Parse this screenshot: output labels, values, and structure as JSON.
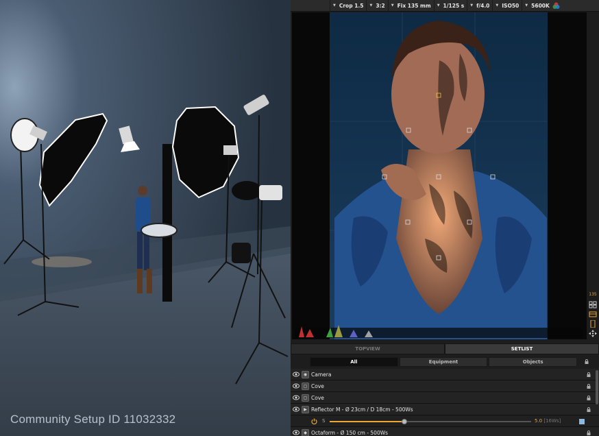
{
  "viewport": {
    "community_label": "Community Setup ID 11032332"
  },
  "camera_toolbar": {
    "items": [
      {
        "label": "Crop 1.5"
      },
      {
        "label": "3:2"
      },
      {
        "label": "Fix 135 mm"
      },
      {
        "label": "1/125 s"
      },
      {
        "label": "f/4.0"
      },
      {
        "label": "ISO50"
      },
      {
        "label": "5600K"
      }
    ],
    "color_icon": "color-wheel-icon"
  },
  "side_strip": {
    "value": "135"
  },
  "view_tabs": [
    {
      "label": "TOPVIEW",
      "active": false
    },
    {
      "label": "SETLIST",
      "active": true
    }
  ],
  "filter_tabs": [
    {
      "label": "All",
      "active": true
    },
    {
      "label": "Equipment",
      "active": false
    },
    {
      "label": "Objects",
      "active": false
    }
  ],
  "setlist": {
    "rows": [
      {
        "label": "Camera",
        "icon": "camera-icon"
      },
      {
        "label": "Cove",
        "icon": "cove-icon"
      },
      {
        "label": "Cove",
        "icon": "cove-icon"
      },
      {
        "label": "Reflector M - Ø 23cm / D 18cm - 500Ws",
        "icon": "reflector-icon"
      },
      {
        "label": "Octaform - Ø 150 cm - 500Ws",
        "icon": "octaform-icon"
      }
    ],
    "slider": {
      "letter": "S",
      "value": "5.0",
      "suffix": "[16Ws]",
      "fraction": 0.37
    }
  },
  "colors": {
    "accent": "#f0a830",
    "background": "#1d1d1d",
    "studio_blue": "#3a4c5f"
  }
}
